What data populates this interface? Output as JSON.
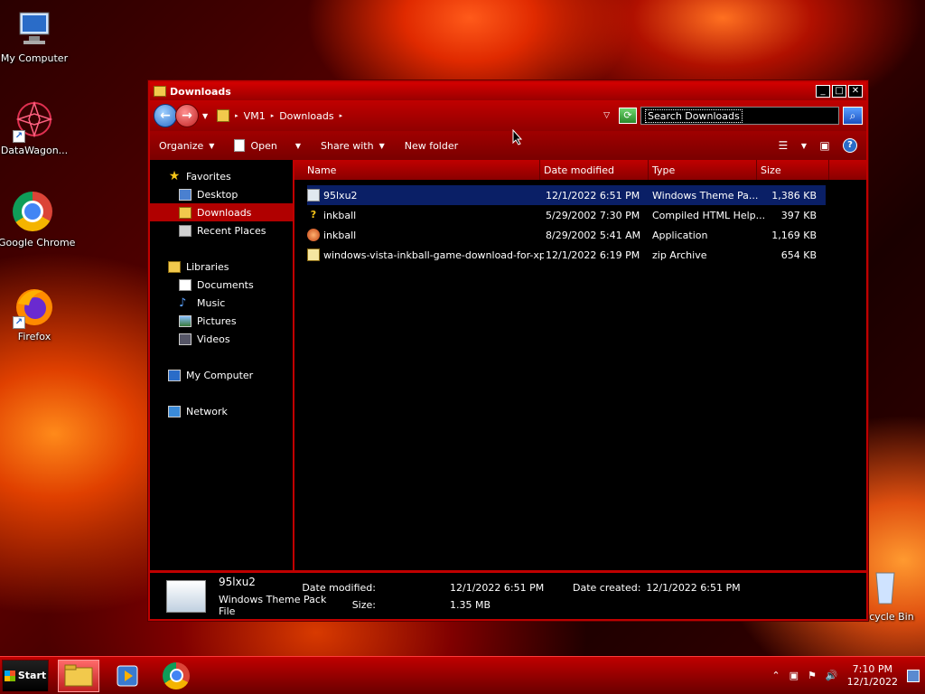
{
  "desktop": {
    "icons": [
      {
        "label": "My Computer"
      },
      {
        "label": "DataWagon..."
      },
      {
        "label": "Google Chrome"
      },
      {
        "label": "Firefox"
      },
      {
        "label": "Recycle Bin"
      }
    ]
  },
  "window": {
    "title": "Downloads",
    "breadcrumb": [
      "VM1",
      "Downloads"
    ],
    "search_placeholder": "Search Downloads",
    "toolbar": {
      "organize": "Organize",
      "open": "Open",
      "share_with": "Share with",
      "new_folder": "New folder"
    },
    "nav": {
      "favorites": "Favorites",
      "desktop": "Desktop",
      "downloads": "Downloads",
      "recent_places": "Recent Places",
      "libraries": "Libraries",
      "documents": "Documents",
      "music": "Music",
      "pictures": "Pictures",
      "videos": "Videos",
      "my_computer": "My Computer",
      "network": "Network"
    },
    "columns": {
      "name": "Name",
      "date": "Date modified",
      "type": "Type",
      "size": "Size"
    },
    "files": [
      {
        "name": "95lxu2",
        "date": "12/1/2022 6:51 PM",
        "type": "Windows Theme Pa...",
        "size": "1,386 KB"
      },
      {
        "name": "inkball",
        "date": "5/29/2002 7:30 PM",
        "type": "Compiled HTML Help...",
        "size": "397 KB"
      },
      {
        "name": "inkball",
        "date": "8/29/2002 5:41 AM",
        "type": "Application",
        "size": "1,169 KB"
      },
      {
        "name": "windows-vista-inkball-game-download-for-xp...",
        "date": "12/1/2022 6:19 PM",
        "type": "zip Archive",
        "size": "654 KB"
      }
    ],
    "details": {
      "name": "95lxu2",
      "type": "Windows Theme Pack File",
      "date_modified_label": "Date modified:",
      "date_modified": "12/1/2022 6:51 PM",
      "size_label": "Size:",
      "size": "1.35 MB",
      "date_created_label": "Date created:",
      "date_created": "12/1/2022 6:51 PM"
    }
  },
  "taskbar": {
    "start": "Start",
    "time": "7:10 PM",
    "date": "12/1/2022"
  }
}
